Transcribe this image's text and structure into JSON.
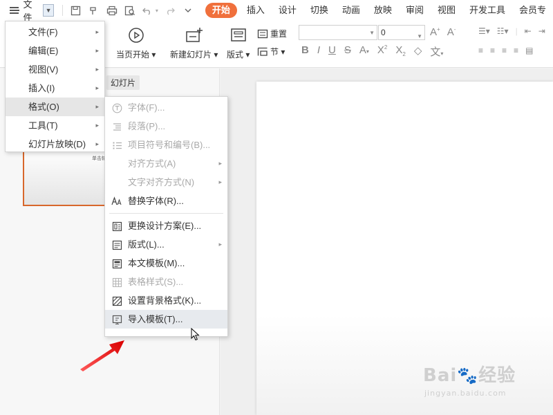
{
  "menubar": {
    "file_label": "文件",
    "tabs": [
      "开始",
      "插入",
      "设计",
      "切换",
      "动画",
      "放映",
      "审阅",
      "视图",
      "开发工具",
      "会员专"
    ],
    "active_tab": "开始"
  },
  "ribbon": {
    "play_from_current": "当页开始",
    "new_slide": "新建幻灯片",
    "layout": "版式",
    "reset": "重置",
    "section": "节",
    "font_name": "",
    "font_size": "0"
  },
  "panel": {
    "label": "幻灯片",
    "thumb_text": "单击输"
  },
  "main_menu": {
    "items": [
      {
        "label": "文件(F)",
        "submenu": true
      },
      {
        "label": "编辑(E)",
        "submenu": true
      },
      {
        "label": "视图(V)",
        "submenu": true
      },
      {
        "label": "插入(I)",
        "submenu": true
      },
      {
        "label": "格式(O)",
        "submenu": true,
        "highlighted": true
      },
      {
        "label": "工具(T)",
        "submenu": true
      },
      {
        "label": "幻灯片放映(D)",
        "submenu": true
      }
    ]
  },
  "format_menu": {
    "items": [
      {
        "label": "字体(F)...",
        "disabled": true,
        "icon": "font-t-icon"
      },
      {
        "label": "段落(P)...",
        "disabled": true,
        "icon": "paragraph-icon"
      },
      {
        "label": "项目符号和编号(B)...",
        "disabled": true,
        "icon": "bullet-list-icon"
      },
      {
        "label": "对齐方式(A)",
        "disabled": true,
        "submenu": true
      },
      {
        "label": "文字对齐方式(N)",
        "disabled": true,
        "submenu": true
      },
      {
        "label": "替换字体(R)...",
        "disabled": false,
        "icon": "replace-font-icon"
      },
      {
        "label": "更换设计方案(E)...",
        "disabled": false,
        "icon": "design-scheme-icon"
      },
      {
        "label": "版式(L)...",
        "disabled": false,
        "submenu": true,
        "icon": "layout-icon"
      },
      {
        "label": "本文模板(M)...",
        "disabled": false,
        "icon": "template-icon"
      },
      {
        "label": "表格样式(S)...",
        "disabled": true,
        "icon": "table-style-icon"
      },
      {
        "label": "设置背景格式(K)...",
        "disabled": false,
        "icon": "background-format-icon"
      },
      {
        "label": "导入模板(T)...",
        "disabled": false,
        "highlighted": true,
        "icon": "import-template-icon"
      }
    ]
  },
  "watermark": {
    "logo": "Bai",
    "logo2": "经验",
    "sub": "jingyan.baidu.com"
  },
  "colors": {
    "accent": "#f0703c",
    "annotation_arrow": "#e02020"
  }
}
